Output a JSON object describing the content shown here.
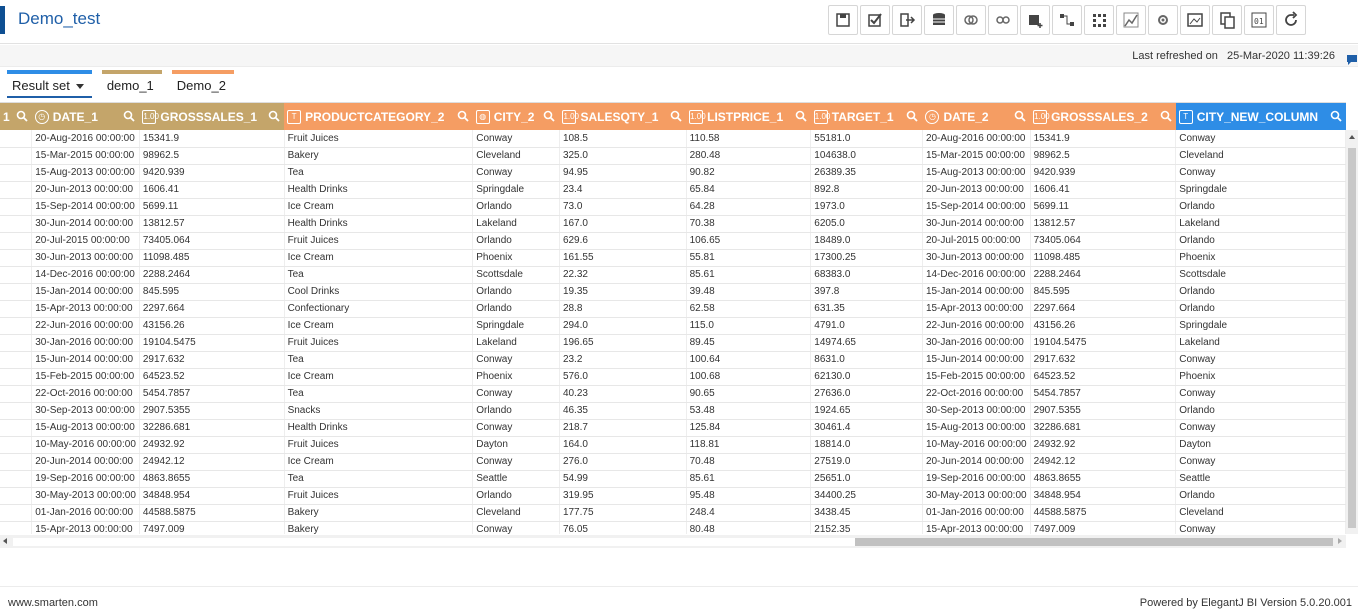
{
  "app": {
    "title": "Demo_test",
    "refresh_label": "Last refreshed on",
    "refresh_time": "25-Mar-2020 11:39:26"
  },
  "toolbar": [
    {
      "name": "save-icon"
    },
    {
      "name": "validate-icon"
    },
    {
      "name": "export-icon"
    },
    {
      "name": "database-icon"
    },
    {
      "name": "merge-icon"
    },
    {
      "name": "link-icon"
    },
    {
      "name": "add-dataset-icon"
    },
    {
      "name": "relationship-icon"
    },
    {
      "name": "grid-icon"
    },
    {
      "name": "chart-edit-icon"
    },
    {
      "name": "settings-icon"
    },
    {
      "name": "image-icon"
    },
    {
      "name": "copy-icon"
    },
    {
      "name": "binary-icon"
    },
    {
      "name": "refresh-icon"
    }
  ],
  "tabs": [
    {
      "label": "Result set",
      "color": "#2e8de6",
      "active": true
    },
    {
      "label": "demo_1",
      "color": "#c4a56a",
      "active": false
    },
    {
      "label": "Demo_2",
      "color": "#f59d63",
      "active": false
    }
  ],
  "columns": [
    {
      "label": "1",
      "icon": "none",
      "color": "tan"
    },
    {
      "label": "DATE_1",
      "icon": "clock",
      "color": "tan"
    },
    {
      "label": "GROSSSALES_1",
      "icon": "num",
      "color": "tan"
    },
    {
      "label": "PRODUCTCATEGORY_2",
      "icon": "text",
      "color": "orange"
    },
    {
      "label": "CITY_2",
      "icon": "geo",
      "color": "orange"
    },
    {
      "label": "SALESQTY_1",
      "icon": "num",
      "color": "orange"
    },
    {
      "label": "LISTPRICE_1",
      "icon": "num",
      "color": "orange"
    },
    {
      "label": "TARGET_1",
      "icon": "num",
      "color": "orange"
    },
    {
      "label": "DATE_2",
      "icon": "clock",
      "color": "orange"
    },
    {
      "label": "GROSSSALES_2",
      "icon": "num",
      "color": "orange"
    },
    {
      "label": "CITY_NEW_COLUMN",
      "icon": "text",
      "color": "blue"
    }
  ],
  "rows": [
    [
      "",
      "20-Aug-2016 00:00:00",
      "15341.9",
      "Fruit Juices",
      "Conway",
      "108.5",
      "110.58",
      "55181.0",
      "20-Aug-2016 00:00:00",
      "15341.9",
      "Conway"
    ],
    [
      "",
      "15-Mar-2015 00:00:00",
      "98962.5",
      "Bakery",
      "Cleveland",
      "325.0",
      "280.48",
      "104638.0",
      "15-Mar-2015 00:00:00",
      "98962.5",
      "Cleveland"
    ],
    [
      "",
      "15-Aug-2013 00:00:00",
      "9420.939",
      "Tea",
      "Conway",
      "94.95",
      "90.82",
      "26389.35",
      "15-Aug-2013 00:00:00",
      "9420.939",
      "Conway"
    ],
    [
      "",
      "20-Jun-2013 00:00:00",
      "1606.41",
      "Health Drinks",
      "Springdale",
      "23.4",
      "65.84",
      "892.8",
      "20-Jun-2013 00:00:00",
      "1606.41",
      "Springdale"
    ],
    [
      "",
      "15-Sep-2014 00:00:00",
      "5699.11",
      "Ice Cream",
      "Orlando",
      "73.0",
      "64.28",
      "1973.0",
      "15-Sep-2014 00:00:00",
      "5699.11",
      "Orlando"
    ],
    [
      "",
      "30-Jun-2014 00:00:00",
      "13812.57",
      "Health Drinks",
      "Lakeland",
      "167.0",
      "70.38",
      "6205.0",
      "30-Jun-2014 00:00:00",
      "13812.57",
      "Lakeland"
    ],
    [
      "",
      "20-Jul-2015 00:00:00",
      "73405.064",
      "Fruit Juices",
      "Orlando",
      "629.6",
      "106.65",
      "18489.0",
      "20-Jul-2015 00:00:00",
      "73405.064",
      "Orlando"
    ],
    [
      "",
      "30-Jun-2013 00:00:00",
      "11098.485",
      "Ice Cream",
      "Phoenix",
      "161.55",
      "55.81",
      "17300.25",
      "30-Jun-2013 00:00:00",
      "11098.485",
      "Phoenix"
    ],
    [
      "",
      "14-Dec-2016 00:00:00",
      "2288.2464",
      "Tea",
      "Scottsdale",
      "22.32",
      "85.61",
      "68383.0",
      "14-Dec-2016 00:00:00",
      "2288.2464",
      "Scottsdale"
    ],
    [
      "",
      "15-Jan-2014 00:00:00",
      "845.595",
      "Cool Drinks",
      "Orlando",
      "19.35",
      "39.48",
      "397.8",
      "15-Jan-2014 00:00:00",
      "845.595",
      "Orlando"
    ],
    [
      "",
      "15-Apr-2013 00:00:00",
      "2297.664",
      "Confectionary",
      "Orlando",
      "28.8",
      "62.58",
      "631.35",
      "15-Apr-2013 00:00:00",
      "2297.664",
      "Orlando"
    ],
    [
      "",
      "22-Jun-2016 00:00:00",
      "43156.26",
      "Ice Cream",
      "Springdale",
      "294.0",
      "115.0",
      "4791.0",
      "22-Jun-2016 00:00:00",
      "43156.26",
      "Springdale"
    ],
    [
      "",
      "30-Jan-2016 00:00:00",
      "19104.5475",
      "Fruit Juices",
      "Lakeland",
      "196.65",
      "89.45",
      "14974.65",
      "30-Jan-2016 00:00:00",
      "19104.5475",
      "Lakeland"
    ],
    [
      "",
      "15-Jun-2014 00:00:00",
      "2917.632",
      "Tea",
      "Conway",
      "23.2",
      "100.64",
      "8631.0",
      "15-Jun-2014 00:00:00",
      "2917.632",
      "Conway"
    ],
    [
      "",
      "15-Feb-2015 00:00:00",
      "64523.52",
      "Ice Cream",
      "Phoenix",
      "576.0",
      "100.68",
      "62130.0",
      "15-Feb-2015 00:00:00",
      "64523.52",
      "Phoenix"
    ],
    [
      "",
      "22-Oct-2016 00:00:00",
      "5454.7857",
      "Tea",
      "Conway",
      "40.23",
      "90.65",
      "27636.0",
      "22-Oct-2016 00:00:00",
      "5454.7857",
      "Conway"
    ],
    [
      "",
      "30-Sep-2013 00:00:00",
      "2907.5355",
      "Snacks",
      "Orlando",
      "46.35",
      "53.48",
      "1924.65",
      "30-Sep-2013 00:00:00",
      "2907.5355",
      "Orlando"
    ],
    [
      "",
      "15-Aug-2013 00:00:00",
      "32286.681",
      "Health Drinks",
      "Conway",
      "218.7",
      "125.84",
      "30461.4",
      "15-Aug-2013 00:00:00",
      "32286.681",
      "Conway"
    ],
    [
      "",
      "10-May-2016 00:00:00",
      "24932.92",
      "Fruit Juices",
      "Dayton",
      "164.0",
      "118.81",
      "18814.0",
      "10-May-2016 00:00:00",
      "24932.92",
      "Dayton"
    ],
    [
      "",
      "20-Jun-2014 00:00:00",
      "24942.12",
      "Ice Cream",
      "Conway",
      "276.0",
      "70.48",
      "27519.0",
      "20-Jun-2014 00:00:00",
      "24942.12",
      "Conway"
    ],
    [
      "",
      "19-Sep-2016 00:00:00",
      "4863.8655",
      "Tea",
      "Seattle",
      "54.99",
      "85.61",
      "25651.0",
      "19-Sep-2016 00:00:00",
      "4863.8655",
      "Seattle"
    ],
    [
      "",
      "30-May-2013 00:00:00",
      "34848.954",
      "Fruit Juices",
      "Orlando",
      "319.95",
      "95.48",
      "34400.25",
      "30-May-2013 00:00:00",
      "34848.954",
      "Orlando"
    ],
    [
      "",
      "01-Jan-2016 00:00:00",
      "44588.5875",
      "Bakery",
      "Cleveland",
      "177.75",
      "248.4",
      "3438.45",
      "01-Jan-2016 00:00:00",
      "44588.5875",
      "Cleveland"
    ],
    [
      "",
      "15-Apr-2013 00:00:00",
      "7497.009",
      "Bakery",
      "Conway",
      "76.05",
      "80.48",
      "2152.35",
      "15-Apr-2013 00:00:00",
      "7497.009",
      "Conway"
    ]
  ],
  "footer": {
    "left": "www.smarten.com",
    "right": "Powered by ElegantJ BI Version 5.0.20.001"
  }
}
